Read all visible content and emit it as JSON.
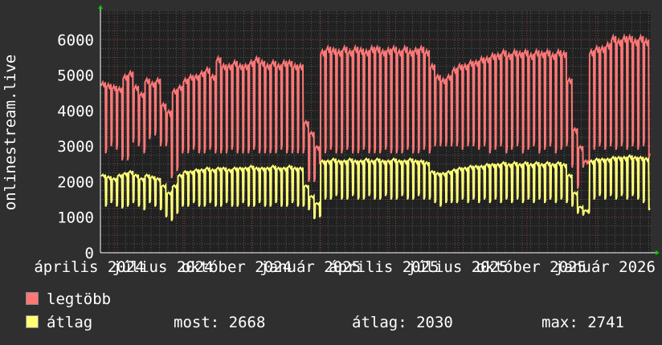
{
  "chart_data": {
    "type": "line",
    "ylabel": "onlinestream.live",
    "ylim": [
      0,
      6800
    ],
    "yticks": [
      0,
      1000,
      2000,
      3000,
      4000,
      5000,
      6000
    ],
    "xtick_labels": [
      "április 2024",
      "július 2024",
      "október 2024",
      "január 2025",
      "április 2025",
      "július 2025",
      "október 2025",
      "január 2026"
    ],
    "grid": true,
    "legend_placement": "bottom-left",
    "series": [
      {
        "name": "legtöbb",
        "color": "#ff7777",
        "weekly_high": [
          4800,
          4750,
          4700,
          4650,
          5000,
          5100,
          4700,
          4500,
          4900,
          4800,
          4900,
          4200,
          4000,
          4600,
          4700,
          4900,
          5000,
          5000,
          5100,
          5200,
          5000,
          5500,
          5300,
          5300,
          5400,
          5300,
          5300,
          5400,
          5500,
          5400,
          5300,
          5400,
          5300,
          5400,
          5400,
          5300,
          5300,
          3700,
          3400,
          3000,
          5700,
          5800,
          5750,
          5700,
          5800,
          5700,
          5800,
          5750,
          5700,
          5800,
          5800,
          5700,
          5750,
          5800,
          5700,
          5800,
          5700,
          5750,
          5800,
          5700,
          5300,
          5000,
          4900,
          5000,
          5200,
          5300,
          5300,
          5400,
          5400,
          5500,
          5500,
          5600,
          5600,
          5700,
          5600,
          5700,
          5650,
          5700,
          5600,
          5700,
          5650,
          5700,
          5600,
          5700,
          5650,
          4900,
          3500,
          3000,
          2600,
          5700,
          5800,
          5800,
          5900,
          6100,
          6000,
          6100,
          6100,
          6000,
          6100,
          6000
        ],
        "weekly_low": [
          2800,
          3000,
          2900,
          2600,
          2600,
          3100,
          3000,
          2800,
          3200,
          3300,
          3000,
          3000,
          2100,
          2300,
          2800,
          2800,
          2900,
          2800,
          2800,
          2900,
          2800,
          2800,
          2800,
          2900,
          2800,
          2800,
          2800,
          2900,
          2800,
          2800,
          2800,
          2800,
          2900,
          2800,
          2800,
          2800,
          2800,
          2000,
          2000,
          2500,
          2800,
          2900,
          2800,
          2800,
          2900,
          2800,
          2800,
          2900,
          2800,
          2800,
          2800,
          2900,
          2800,
          2800,
          2800,
          2900,
          2800,
          2800,
          2900,
          2800,
          3000,
          3000,
          3000,
          3000,
          3000,
          2900,
          3000,
          3000,
          2900,
          3000,
          2800,
          2900,
          3000,
          2800,
          2900,
          3000,
          2800,
          2900,
          3000,
          2800,
          2900,
          3000,
          2800,
          2900,
          3000,
          2400,
          1800,
          2400,
          2500,
          2900,
          3000,
          2900,
          3000,
          2900,
          3000,
          2900,
          3000,
          2900,
          3000,
          2668
        ]
      },
      {
        "name": "átlag",
        "color": "#ffff77",
        "weekly_high": [
          2200,
          2150,
          2100,
          2200,
          2250,
          2300,
          2200,
          2100,
          2200,
          2150,
          2100,
          1900,
          1700,
          1900,
          2200,
          2300,
          2300,
          2350,
          2350,
          2400,
          2350,
          2400,
          2400,
          2350,
          2400,
          2400,
          2400,
          2450,
          2400,
          2400,
          2400,
          2450,
          2400,
          2400,
          2450,
          2400,
          2400,
          1900,
          1600,
          1400,
          2600,
          2600,
          2650,
          2600,
          2600,
          2650,
          2600,
          2600,
          2650,
          2600,
          2650,
          2600,
          2600,
          2650,
          2600,
          2600,
          2650,
          2600,
          2600,
          2550,
          2300,
          2250,
          2250,
          2300,
          2350,
          2400,
          2400,
          2450,
          2450,
          2450,
          2500,
          2500,
          2500,
          2550,
          2500,
          2550,
          2500,
          2550,
          2500,
          2550,
          2500,
          2550,
          2500,
          2550,
          2500,
          2200,
          1700,
          1300,
          1200,
          2600,
          2650,
          2650,
          2650,
          2700,
          2700,
          2700,
          2741,
          2700,
          2700,
          2668
        ],
        "weekly_low": [
          1300,
          1400,
          1300,
          1250,
          1300,
          1400,
          1300,
          1200,
          1400,
          1300,
          1200,
          1000,
          900,
          1100,
          1300,
          1300,
          1400,
          1300,
          1300,
          1400,
          1300,
          1300,
          1400,
          1300,
          1300,
          1400,
          1300,
          1300,
          1400,
          1300,
          1300,
          1400,
          1300,
          1300,
          1400,
          1300,
          1300,
          1200,
          950,
          1000,
          1500,
          1500,
          1600,
          1500,
          1500,
          1600,
          1500,
          1500,
          1600,
          1500,
          1500,
          1600,
          1500,
          1500,
          1600,
          1500,
          1500,
          1600,
          1500,
          1500,
          1400,
          1300,
          1400,
          1400,
          1400,
          1500,
          1400,
          1500,
          1400,
          1500,
          1400,
          1500,
          1400,
          1500,
          1400,
          1500,
          1400,
          1500,
          1400,
          1500,
          1400,
          1500,
          1400,
          1500,
          1400,
          1300,
          1100,
          1050,
          1100,
          1500,
          1600,
          1500,
          1600,
          1500,
          1600,
          1500,
          1600,
          1500,
          1400,
          1200
        ]
      }
    ]
  },
  "legend": {
    "max_label": "legtöbb",
    "avg_label": "átlag",
    "current": "most: 2668",
    "average": "átlag: 2030",
    "maximum": "max: 2741"
  }
}
